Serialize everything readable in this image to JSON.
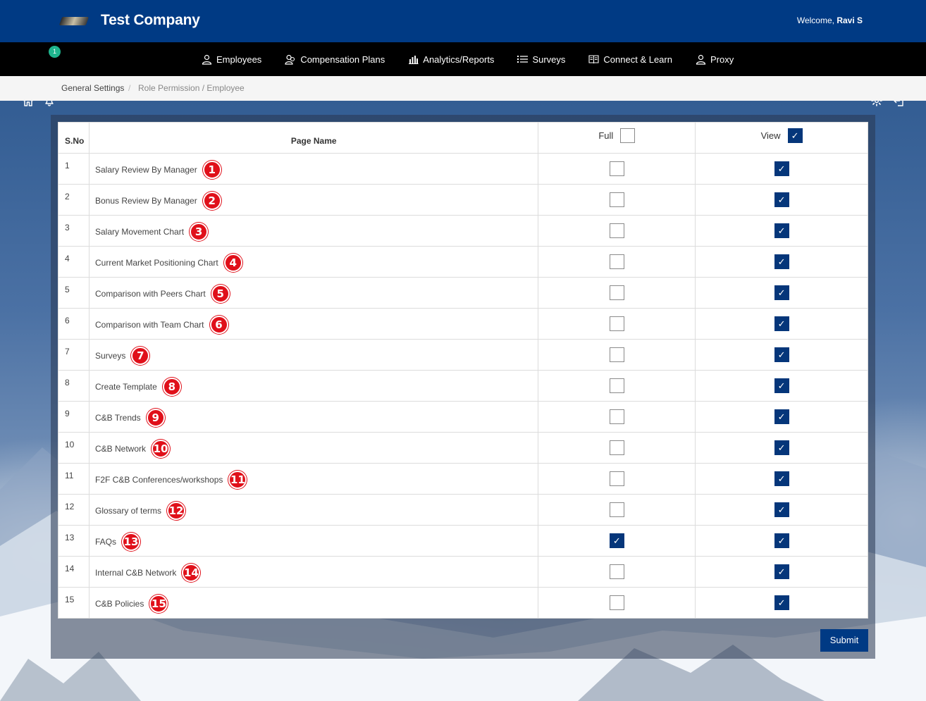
{
  "header": {
    "company": "Test Company",
    "welcome_prefix": "Welcome,",
    "user": "Ravi S"
  },
  "nav": {
    "notification_count": "1",
    "items": [
      {
        "label": "Employees",
        "icon": "user-icon"
      },
      {
        "label": "Compensation Plans",
        "icon": "users-icon"
      },
      {
        "label": "Analytics/Reports",
        "icon": "bar-chart-icon"
      },
      {
        "label": "Surveys",
        "icon": "list-icon"
      },
      {
        "label": "Connect & Learn",
        "icon": "book-icon"
      },
      {
        "label": "Proxy",
        "icon": "user-icon"
      }
    ]
  },
  "breadcrumb": {
    "home": "General Settings",
    "separator": "/",
    "current": "Role Permission / Employee"
  },
  "table": {
    "headers": {
      "sno": "S.No",
      "page": "Page Name",
      "full": "Full",
      "view": "View"
    },
    "header_full_checked": false,
    "header_view_checked": true,
    "rows": [
      {
        "sno": "1",
        "page": "Salary Review By Manager",
        "badge": "1",
        "full": false,
        "view": true
      },
      {
        "sno": "2",
        "page": "Bonus Review By Manager",
        "badge": "2",
        "full": false,
        "view": true
      },
      {
        "sno": "3",
        "page": "Salary Movement Chart",
        "badge": "3",
        "full": false,
        "view": true
      },
      {
        "sno": "4",
        "page": "Current Market Positioning Chart",
        "badge": "4",
        "full": false,
        "view": true
      },
      {
        "sno": "5",
        "page": "Comparison with Peers Chart",
        "badge": "5",
        "full": false,
        "view": true
      },
      {
        "sno": "6",
        "page": "Comparison with Team Chart",
        "badge": "6",
        "full": false,
        "view": true
      },
      {
        "sno": "7",
        "page": "Surveys",
        "badge": "7",
        "full": false,
        "view": true
      },
      {
        "sno": "8",
        "page": "Create Template",
        "badge": "8",
        "full": false,
        "view": true
      },
      {
        "sno": "9",
        "page": "C&B Trends",
        "badge": "9",
        "full": false,
        "view": true
      },
      {
        "sno": "10",
        "page": "C&B Network",
        "badge": "10",
        "full": false,
        "view": true
      },
      {
        "sno": "11",
        "page": "F2F C&B Conferences/workshops",
        "badge": "11",
        "full": false,
        "view": true
      },
      {
        "sno": "12",
        "page": "Glossary of terms",
        "badge": "12",
        "full": false,
        "view": true
      },
      {
        "sno": "13",
        "page": "FAQs",
        "badge": "13",
        "full": true,
        "view": true
      },
      {
        "sno": "14",
        "page": "Internal C&B Network",
        "badge": "14",
        "full": false,
        "view": true
      },
      {
        "sno": "15",
        "page": "C&B Policies",
        "badge": "15",
        "full": false,
        "view": true
      }
    ]
  },
  "actions": {
    "submit": "Submit"
  },
  "colors": {
    "brand": "#003a84",
    "checked": "#05367a",
    "badge": "#e0101a",
    "notif": "#1fb58e"
  }
}
